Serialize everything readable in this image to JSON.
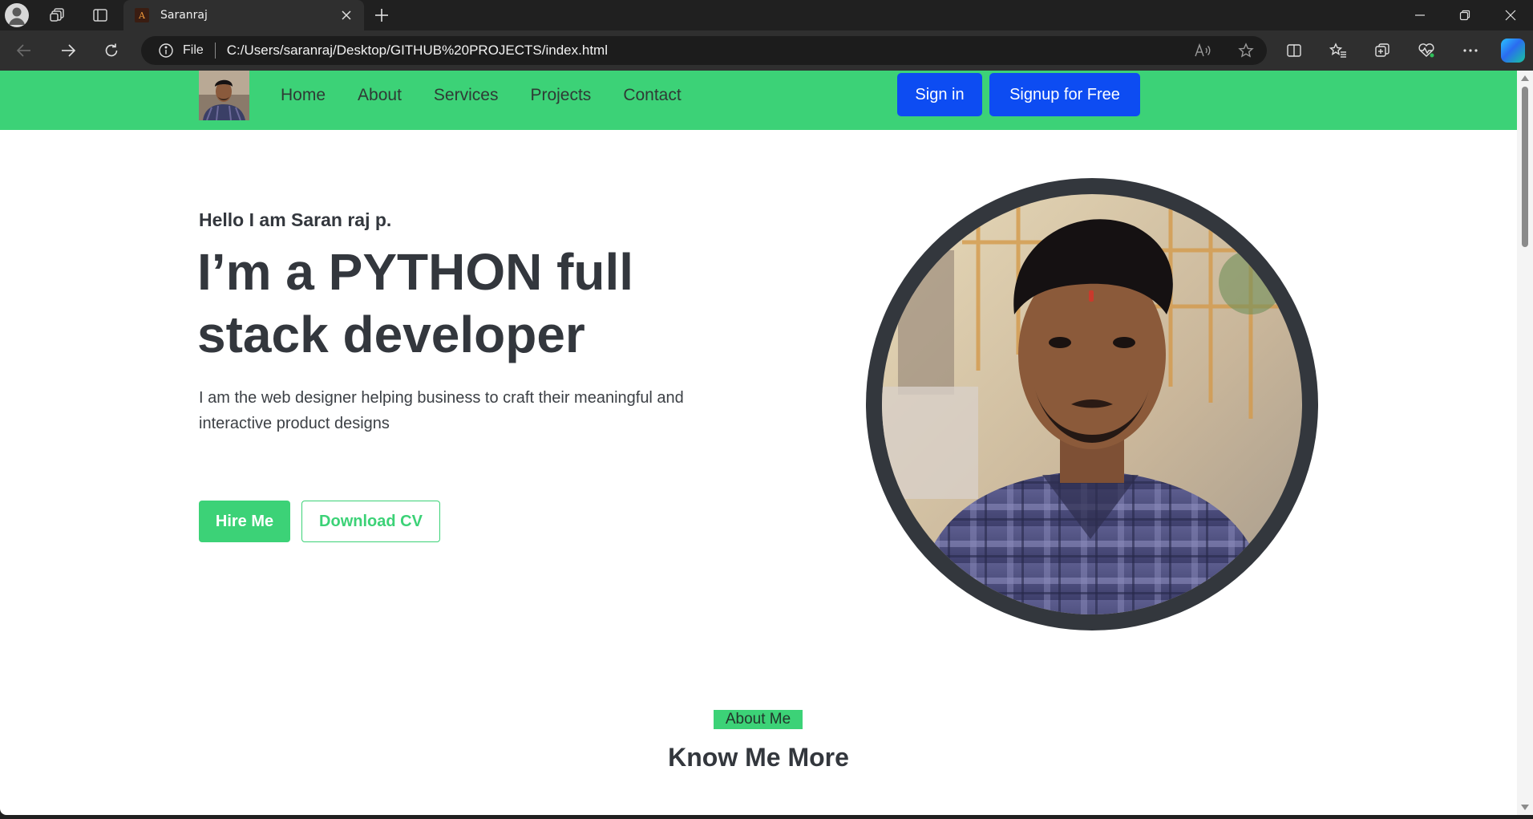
{
  "browser": {
    "tab_title": "Saranraj",
    "address_scheme": "File",
    "address_url": "C:/Users/saranraj/Desktop/GITHUB%20PROJECTS/index.html"
  },
  "nav": {
    "links": [
      "Home",
      "About",
      "Services",
      "Projects",
      "Contact"
    ],
    "signin_label": "Sign in",
    "signup_label": "Signup for Free"
  },
  "hero": {
    "greeting": "Hello I am Saran raj p.",
    "title": "I’m a PYTHON full stack developer",
    "description": "I am the web designer helping business to craft their meaningful and interactive product designs",
    "hire_label": "Hire Me",
    "cv_label": "Download CV"
  },
  "about": {
    "badge": "About Me",
    "title": "Know Me More"
  },
  "colors": {
    "brand_green": "#3cd277",
    "button_blue": "#0d4cf2",
    "text_dark": "#33373d"
  },
  "icons": [
    "profile-icon",
    "workspaces-icon",
    "tab-actions-icon",
    "close-icon",
    "new-tab-icon",
    "minimize-icon",
    "restore-icon",
    "window-close-icon",
    "back-icon",
    "forward-icon",
    "refresh-icon",
    "info-icon",
    "read-aloud-icon",
    "favorite-star-icon",
    "split-screen-icon",
    "favorites-icon",
    "collections-icon",
    "browser-essentials-icon",
    "more-icon",
    "copilot-icon"
  ]
}
